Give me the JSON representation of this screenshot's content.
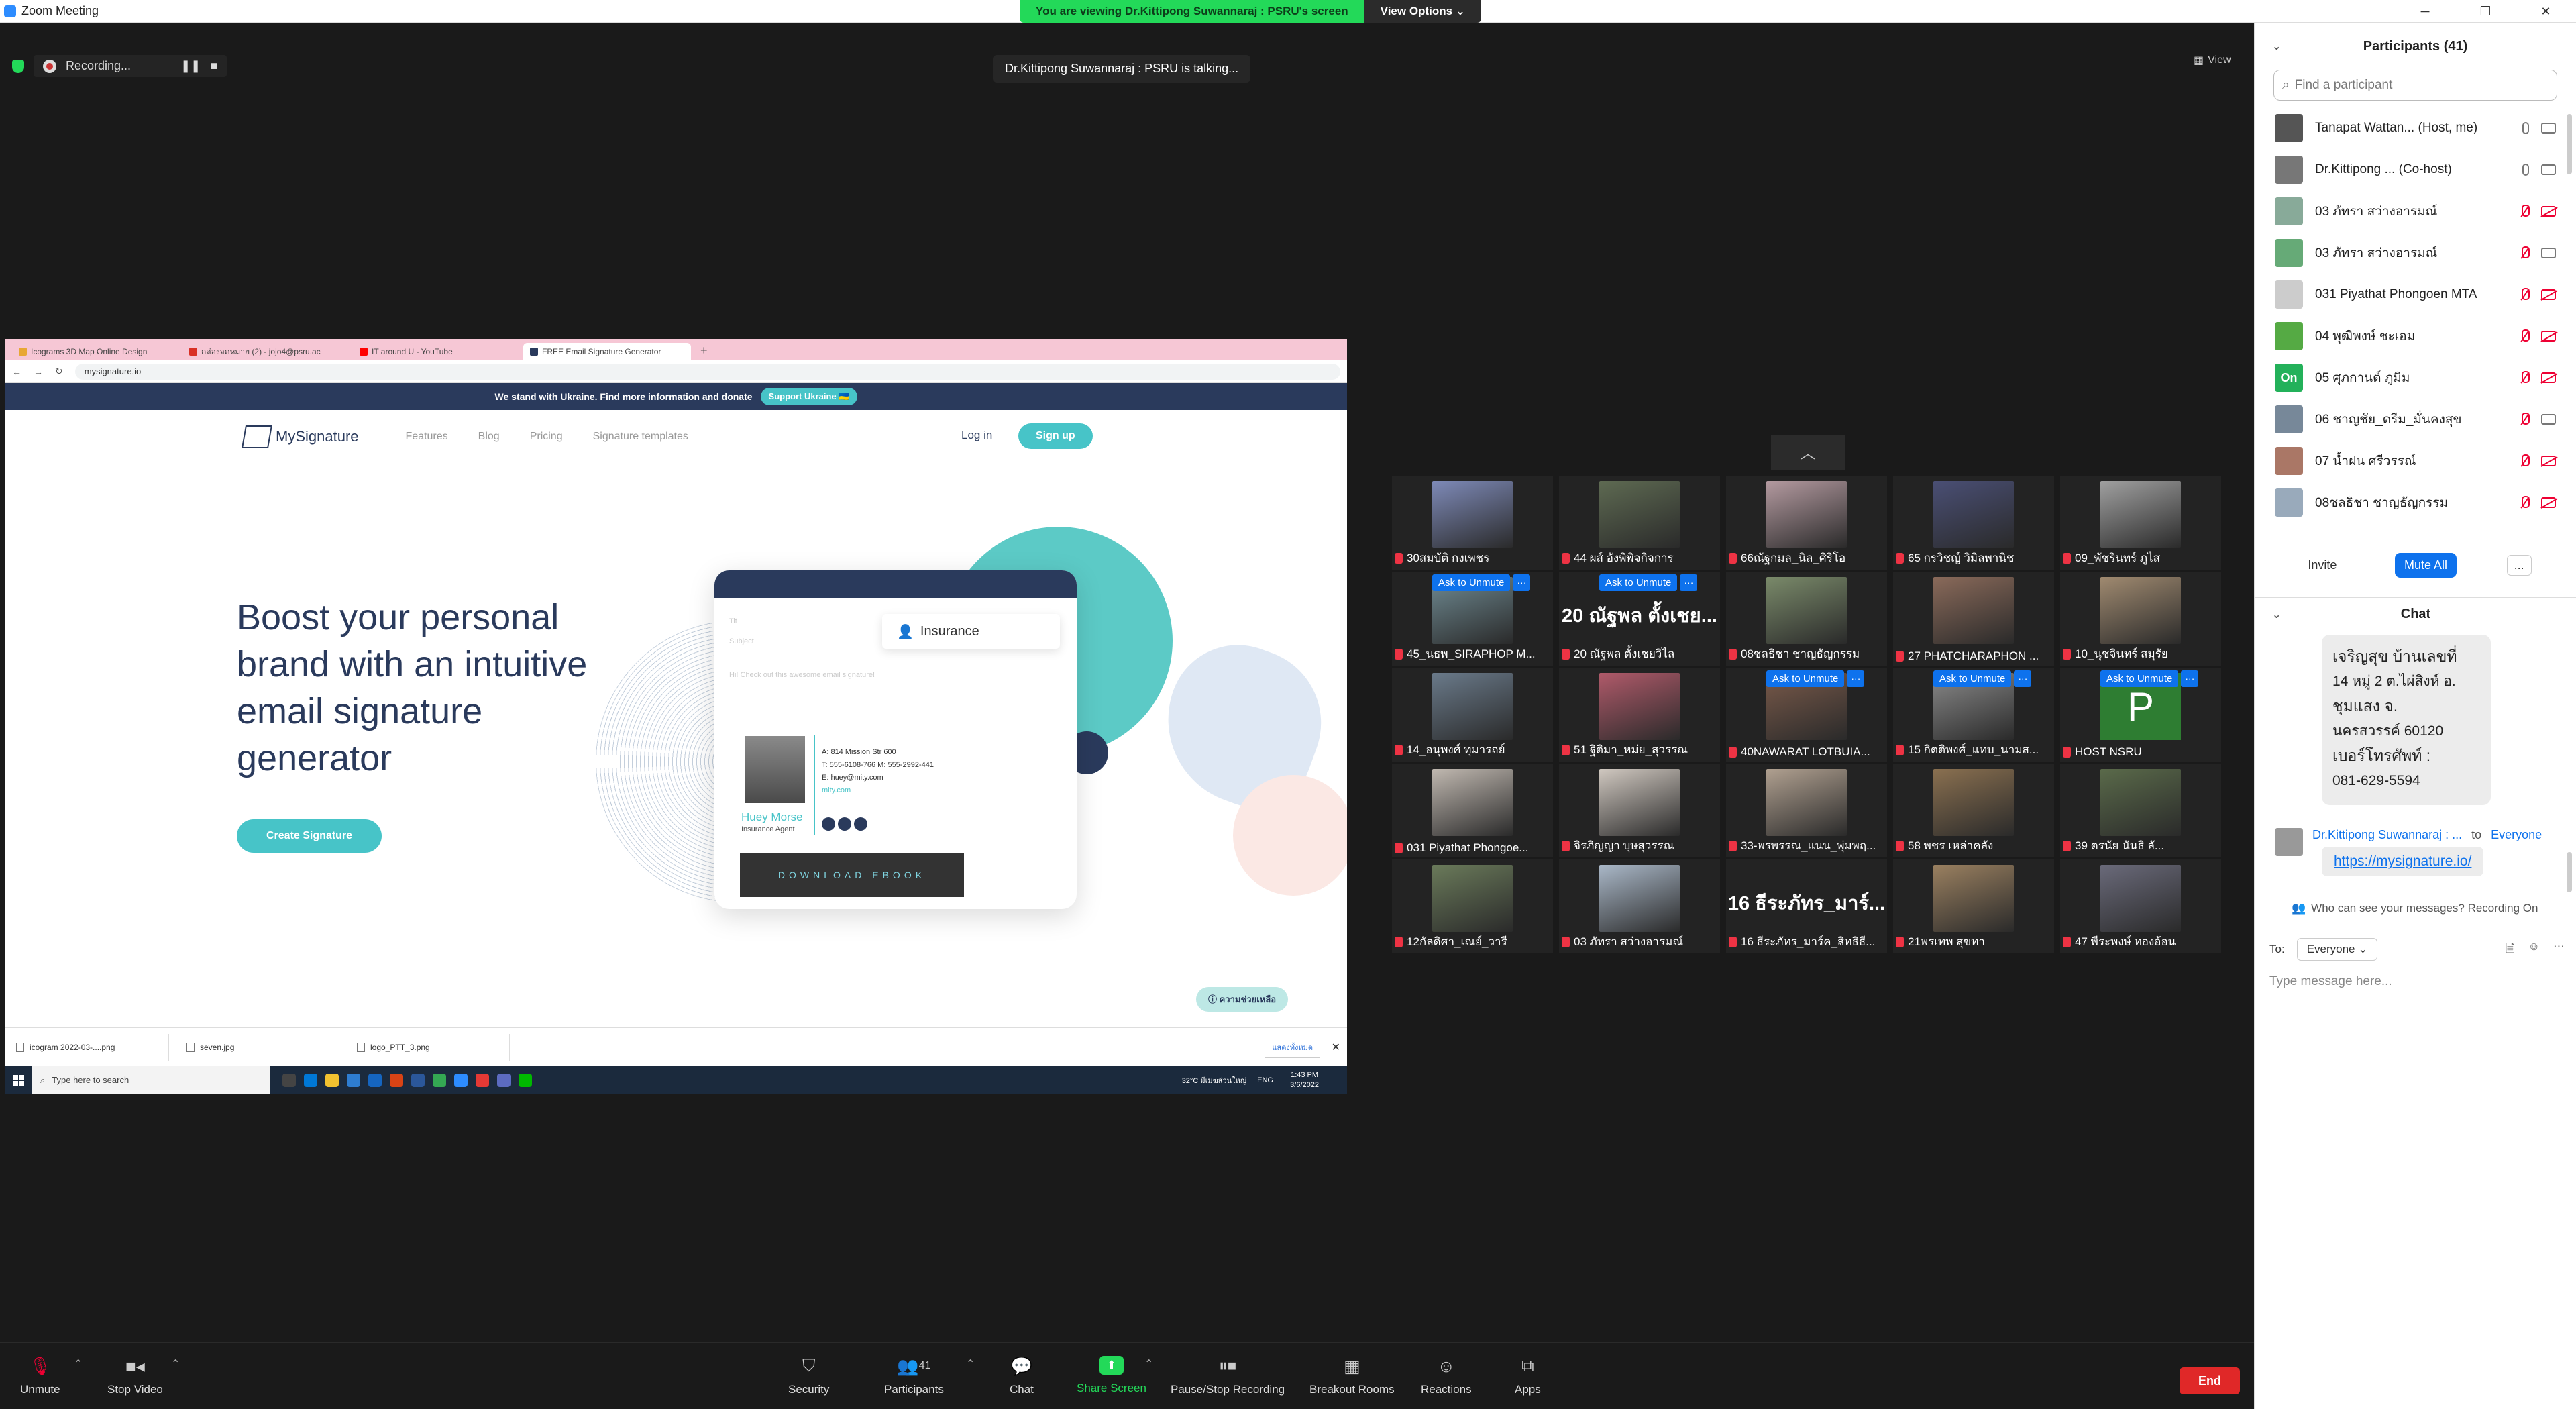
{
  "window": {
    "title": "Zoom Meeting",
    "controls": [
      "─",
      "❐",
      "✕"
    ]
  },
  "banner": {
    "viewing": "You are viewing Dr.Kittipong Suwannaraj : PSRU's screen",
    "view_options": "View Options ⌄"
  },
  "meeting": {
    "recording": "Recording...",
    "rec_pause": "❚❚",
    "rec_stop": "■",
    "talking": "Dr.Kittipong Suwannaraj : PSRU is talking...",
    "view": "View",
    "collapse": "︿"
  },
  "shared": {
    "tabs": [
      "Icograms 3D Map Online Design",
      "กล่องจดหมาย (2) - jojo4@psru.ac",
      "IT around U - YouTube",
      "FREE Email Signature Generator"
    ],
    "new_tab": "+",
    "nav": {
      "back": "←",
      "forward": "→",
      "reload": "↻"
    },
    "url": "mysignature.io",
    "ukraine_text": "We stand with Ukraine. Find more information and donate",
    "ukraine_btn": "Support Ukraine 🇺🇦",
    "logo": "MySignature",
    "menu": [
      "Features",
      "Blog",
      "Pricing",
      "Signature templates"
    ],
    "login": "Log in",
    "signup": "Sign up",
    "hero_line1": "Boost your personal",
    "hero_line2": "brand with an intuitive",
    "hero_line3": "email signature",
    "hero_line4": "generator",
    "cta": "Create Signature",
    "card": {
      "field": "Insurance",
      "faint1": "Tit",
      "faint2": "Subject",
      "faint3": "Hi! Check out this awesome email signature!",
      "name": "Huey Morse",
      "role": "Insurance Agent",
      "info": [
        "A: 814 Mission Str 600",
        "T: 555-6108-766   M: 555-2992-441",
        "E: huey@mity.com",
        "mity.com"
      ],
      "download": "DOWNLOAD EBOOK"
    },
    "help": "ⓘ ความช่วยเหลือ",
    "downloads": [
      "icogram 2022-03-....png",
      "seven.jpg",
      "logo_PTT_3.png"
    ],
    "show_all": "แสดงทั้งหมด",
    "close": "✕",
    "taskbar": {
      "search": "Type here to search",
      "weather": "32°C มีเมฆส่วนใหญ่",
      "lang": "ENG",
      "time": "1:43 PM",
      "date": "3/6/2022"
    }
  },
  "tiles": [
    {
      "name": "30สมบัติ กงเพชร"
    },
    {
      "name": "44 ผส์ อังพิพิจกิจการ"
    },
    {
      "name": "66ณัฐกมล_นิล_ศิริโอ"
    },
    {
      "name": "65 กรวิชญ์ วิมิลพานิช"
    },
    {
      "name": "09_พัชรินทร์ ภูไส"
    },
    {
      "name": "45_นธพ_SIRAPHOP M...",
      "ask": true
    },
    {
      "name": "20 ณัฐพล ตั้งเชยวิไล",
      "ask": true,
      "big": "20 ณัฐพล ตั้งเชย..."
    },
    {
      "name": "08ชลธิชา ชาญธัญกรรม"
    },
    {
      "name": "27 PHATCHARAPHON ..."
    },
    {
      "name": "10_นุชจินทร์ สมุรัย"
    },
    {
      "name": "14_อนุพงศ์ ทุมารถย์"
    },
    {
      "name": "51 ฐิติมา_หม่ย_สุวรรณ"
    },
    {
      "name": "40NAWARAT LOTBUIA...",
      "ask": true
    },
    {
      "name": "15 กิตติพงศ์_แทบ_นามส...",
      "ask": true
    },
    {
      "name": "HOST NSRU",
      "ask": true,
      "letter": "P"
    },
    {
      "name": "031 Piyathat Phongoe..."
    },
    {
      "name": "จิรภิญญา บุษสุวรรณ"
    },
    {
      "name": "33-พรพรรณ_แนน_พุ่มพฤ..."
    },
    {
      "name": "58 พชร เหล่าคลัง"
    },
    {
      "name": "39 ตรนัย นันธิ ลั..."
    },
    {
      "name": "12กัลดิศา_เณย์_วารี"
    },
    {
      "name": "03 ภัทรา สว่างอารมณ์"
    },
    {
      "name": "16 ธีระภัทร_มาร์ค_สิทธิธี...",
      "big": "16 ธีระภัทร_มาร์..."
    },
    {
      "name": "21พรเทพ สุขทา"
    },
    {
      "name": "47 พีระพงษ์ ทองอ้อน"
    }
  ],
  "ask_label": "Ask to Unmute",
  "ask_more": "···",
  "controls": {
    "unmute": "Unmute",
    "stop_video": "Stop Video",
    "security": "Security",
    "participants": "Participants",
    "participants_count": "41",
    "chat": "Chat",
    "share": "Share Screen",
    "record": "Pause/Stop Recording",
    "breakout": "Breakout Rooms",
    "reactions": "Reactions",
    "apps": "Apps",
    "end": "End",
    "caret": "⌃"
  },
  "participants": {
    "header": "Participants (41)",
    "search_placeholder": "Find a participant",
    "list": [
      {
        "name": "Tanapat Wattan...  (Host, me)",
        "mic": "on",
        "cam": "on"
      },
      {
        "name": "Dr.Kittipong ...  (Co-host)",
        "mic": "on",
        "cam": "on"
      },
      {
        "name": "03 ภัทรา สว่างอารมณ์",
        "mic": "off",
        "cam": "off"
      },
      {
        "name": "03 ภัทรา สว่างอารมณ์",
        "mic": "off",
        "cam": "on"
      },
      {
        "name": "031 Piyathat Phongoen MTA",
        "mic": "off",
        "cam": "off"
      },
      {
        "name": "04 พุฒิพงษ์ ชะเอม",
        "mic": "off",
        "cam": "off"
      },
      {
        "name": "05 ศุภกานต์ ภูมิม",
        "mic": "off",
        "cam": "off",
        "initials": "On"
      },
      {
        "name": "06 ชาญชัย_ดรีม_มั่นคงสุข",
        "mic": "off",
        "cam": "on"
      },
      {
        "name": "07 น้ำฝน ศรีวรรณ์",
        "mic": "off",
        "cam": "off"
      },
      {
        "name": "08ชลธิชา ชาญธัญกรรม",
        "mic": "off",
        "cam": "off"
      }
    ],
    "invite": "Invite",
    "mute_all": "Mute All",
    "more": "..."
  },
  "chat": {
    "header": "Chat",
    "lines": [
      "เจริญสุข บ้านเลขที่",
      "14 หมู่ 2 ต.ไผ่สิงห์ อ.",
      "ชุมแสง จ.",
      "นครสวรรค์ 60120",
      "เบอร์โทรศัพท์ :",
      "081-629-5594"
    ],
    "sender": "Dr.Kittipong Suwannaraj : ...",
    "to_label": "to",
    "to_target": "Everyone",
    "link": "https://mysignature.io/",
    "who": "Who can see your messages? Recording On",
    "to": "To:",
    "everyone": "Everyone ⌄",
    "placeholder": "Type message here..."
  }
}
